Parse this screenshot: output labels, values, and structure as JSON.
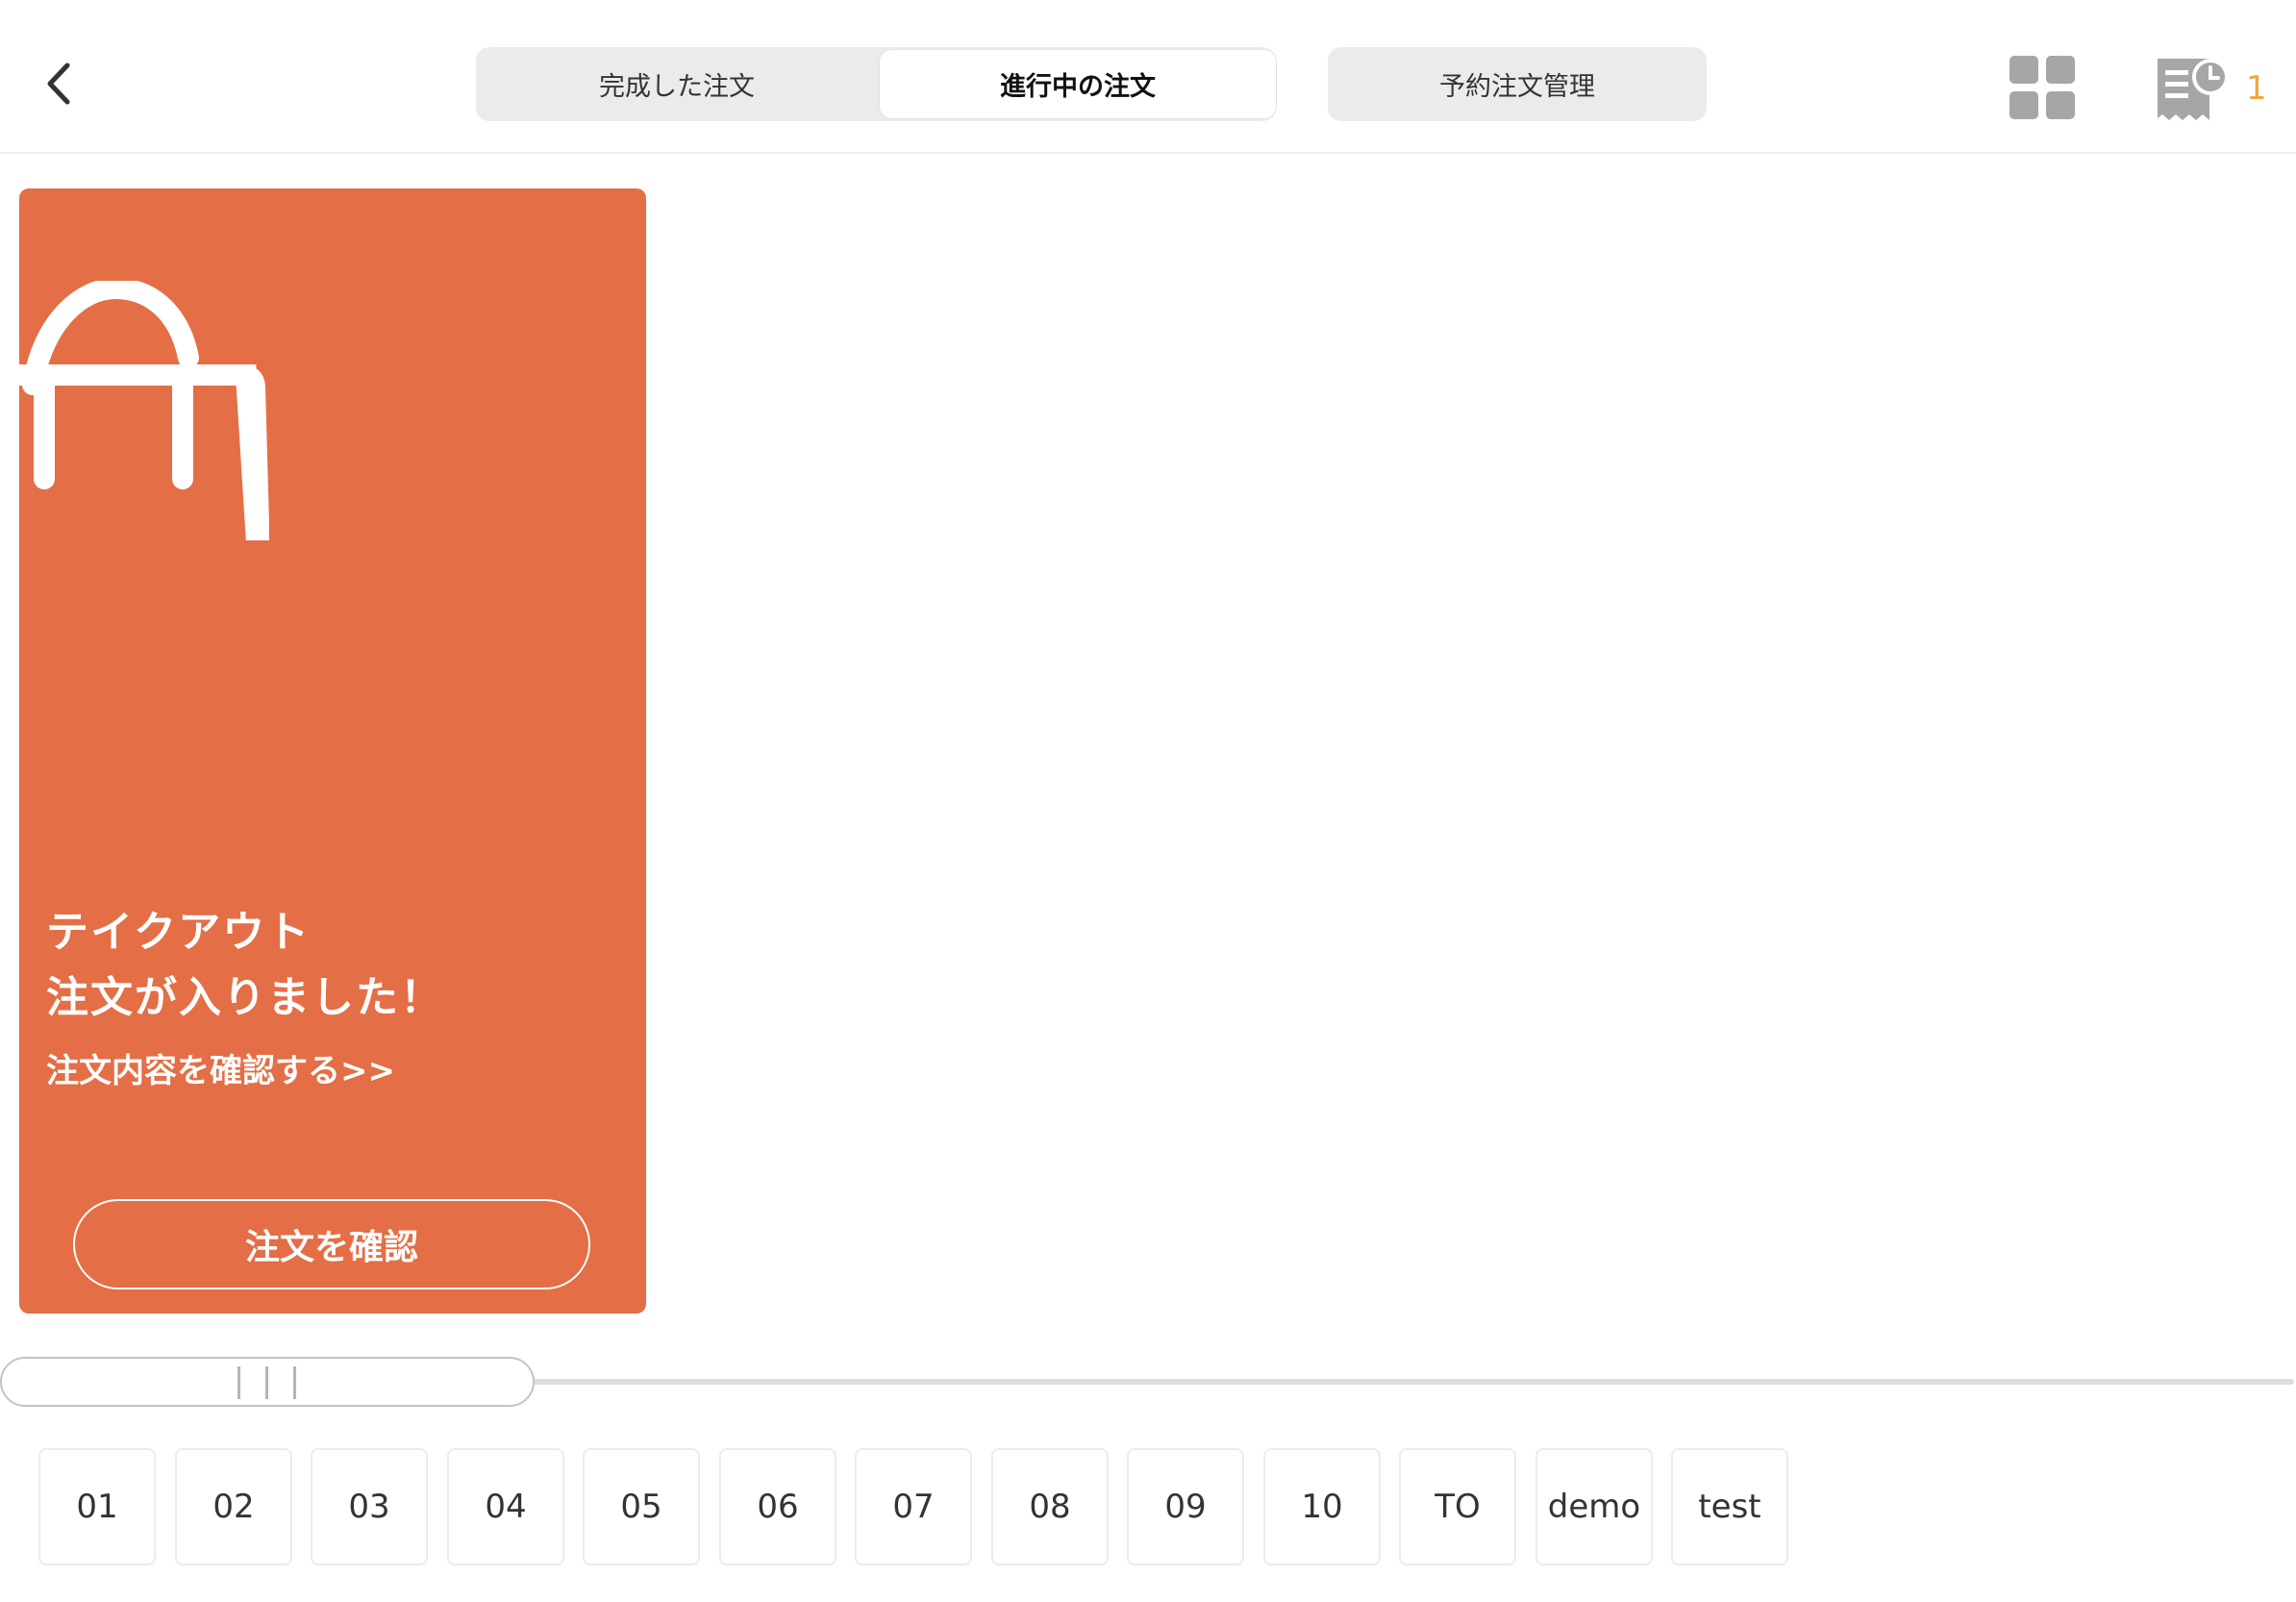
{
  "header": {
    "tabs": [
      {
        "label": "完成した注文",
        "active": false
      },
      {
        "label": "進行中の注文",
        "active": true
      }
    ],
    "reservation_label": "予約注文管理",
    "pending_count": "1",
    "icons": {
      "back": "chevron-left-icon",
      "grid": "grid-icon",
      "receipt": "receipt-clock-icon"
    }
  },
  "order_card": {
    "title_line1": "テイクアウト",
    "title_line2": "注文が入りました！",
    "link_text": "注文内容を確認する>>",
    "button_label": "注文を確認",
    "icon": "shopping-bag-icon",
    "color": "#e46e45"
  },
  "tables": [
    "01",
    "02",
    "03",
    "04",
    "05",
    "06",
    "07",
    "08",
    "09",
    "10",
    "TO",
    "demo",
    "test"
  ],
  "colors": {
    "accent": "#e46e45",
    "badge": "#f0a640",
    "icon_gray": "#a6a6a6"
  }
}
